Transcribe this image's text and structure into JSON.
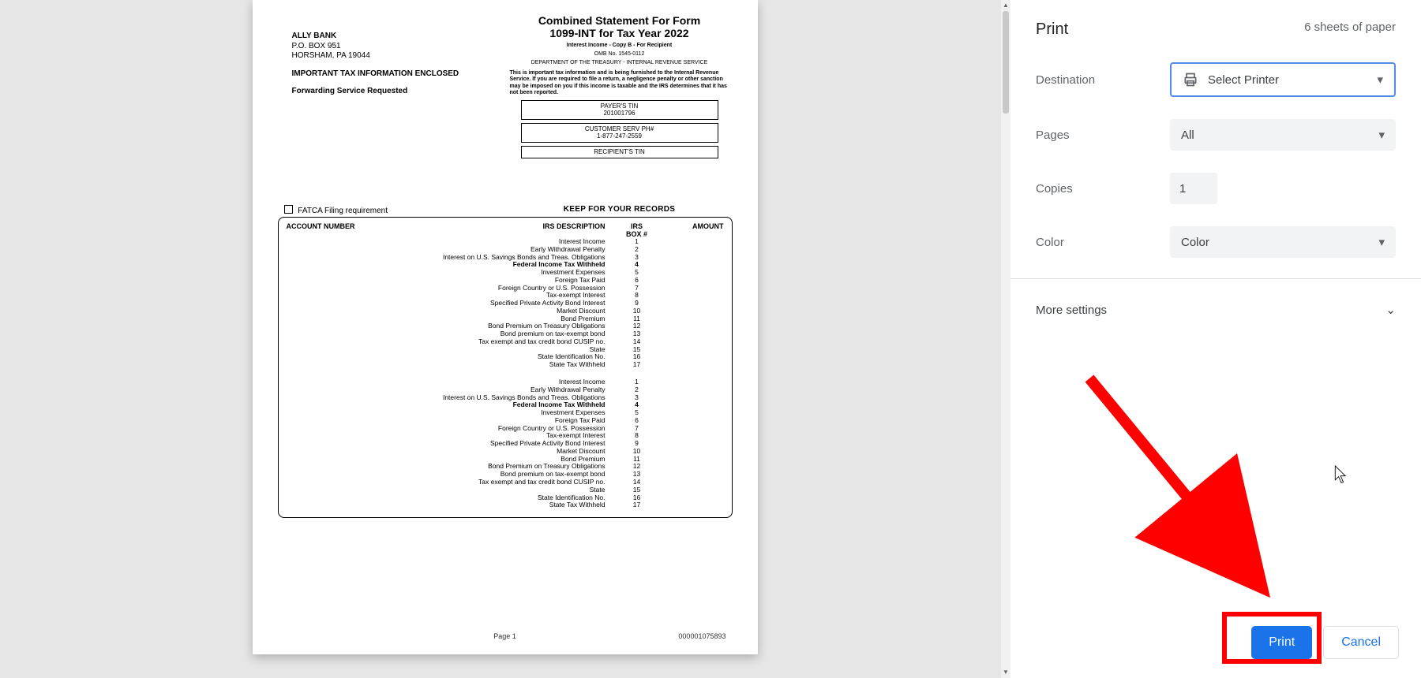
{
  "preview": {
    "sender": {
      "name": "ALLY BANK",
      "addr1": "P.O. BOX 951",
      "addr2": "HORSHAM, PA 19044",
      "notice": "IMPORTANT TAX INFORMATION ENCLOSED",
      "forward": "Forwarding Service Requested"
    },
    "title1": "Combined Statement For Form",
    "title2": "1099-INT for Tax Year 2022",
    "subs": [
      "Interest Income - Copy B - For Recipient",
      "OMB No. 1545-0112",
      "DEPARTMENT OF THE TREASURY - INTERNAL REVENUE SERVICE"
    ],
    "para": "This is important tax information and is being furnished to the Internal Revenue Service. If you are required to file a return, a negligence penalty or other sanction may be imposed on you if this income is taxable and the IRS determines that it has not been reported.",
    "info_boxes": [
      {
        "l1": "PAYER'S TIN",
        "l2": "201001796"
      },
      {
        "l1": "CUSTOMER SERV PH#",
        "l2": "1-877-247-2559"
      },
      {
        "l1": "RECIPIENT'S TIN",
        "l2": ""
      }
    ],
    "fatca": "FATCA Filing requirement",
    "keep": "KEEP FOR YOUR RECORDS",
    "headers": {
      "acct": "ACCOUNT NUMBER",
      "desc": "IRS DESCRIPTION",
      "box_top": "IRS",
      "box": "BOX #",
      "amt": "AMOUNT"
    },
    "rows": [
      {
        "desc": "Interest Income",
        "box": "1",
        "bold": false
      },
      {
        "desc": "Early Withdrawal Penalty",
        "box": "2",
        "bold": false
      },
      {
        "desc": "Interest on U.S. Savings Bonds and Treas. Obligations",
        "box": "3",
        "bold": false
      },
      {
        "desc": "Federal Income Tax Withheld",
        "box": "4",
        "bold": true
      },
      {
        "desc": "Investment Expenses",
        "box": "5",
        "bold": false
      },
      {
        "desc": "Foreign Tax Paid",
        "box": "6",
        "bold": false
      },
      {
        "desc": "Foreign Country or U.S. Possession",
        "box": "7",
        "bold": false
      },
      {
        "desc": "Tax-exempt Interest",
        "box": "8",
        "bold": false
      },
      {
        "desc": "Specified Private Activity Bond Interest",
        "box": "9",
        "bold": false
      },
      {
        "desc": "Market Discount",
        "box": "10",
        "bold": false
      },
      {
        "desc": "Bond Premium",
        "box": "11",
        "bold": false
      },
      {
        "desc": "Bond Premium on Treasury Obligations",
        "box": "12",
        "bold": false
      },
      {
        "desc": "Bond premium on tax-exempt bond",
        "box": "13",
        "bold": false
      },
      {
        "desc": "Tax exempt and tax credit bond CUSIP no.",
        "box": "14",
        "bold": false
      },
      {
        "desc": "State",
        "box": "15",
        "bold": false
      },
      {
        "desc": "State Identification No.",
        "box": "16",
        "bold": false
      },
      {
        "desc": "State Tax Withheld",
        "box": "17",
        "bold": false
      }
    ],
    "page_label": "Page 1",
    "doc_id": "000001075893"
  },
  "dialog": {
    "title": "Print",
    "sheets": "6 sheets of paper",
    "labels": {
      "destination": "Destination",
      "pages": "Pages",
      "copies": "Copies",
      "color": "Color",
      "more": "More settings"
    },
    "values": {
      "destination": "Select Printer",
      "pages": "All",
      "copies": "1",
      "color": "Color"
    },
    "buttons": {
      "print": "Print",
      "cancel": "Cancel"
    }
  }
}
